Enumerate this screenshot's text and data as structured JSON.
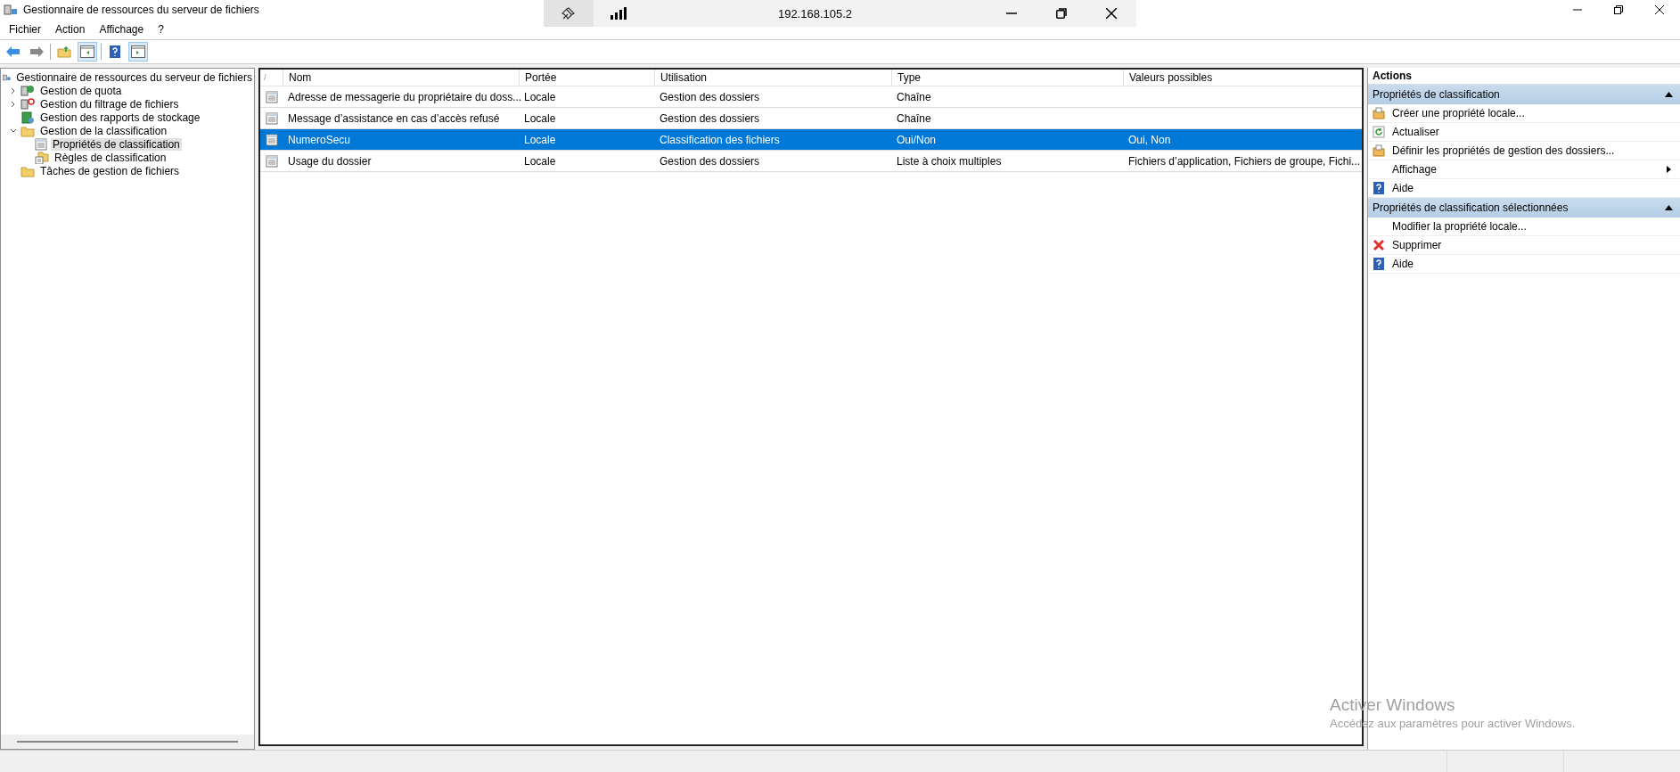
{
  "window": {
    "title": "Gestionnaire de ressources du serveur de fichiers"
  },
  "remote_bar": {
    "address": "192.168.105.2"
  },
  "menu": [
    {
      "label": "Fichier"
    },
    {
      "label": "Action"
    },
    {
      "label": "Affichage"
    },
    {
      "label": "?"
    }
  ],
  "tree": {
    "label": "Gestionnaire de ressources du serveur de fichiers",
    "selected": false,
    "children": [
      {
        "label": "Gestion de quota",
        "kind": "quota",
        "expanded": false,
        "selected": false
      },
      {
        "label": "Gestion du filtrage de fichiers",
        "kind": "filter",
        "expanded": false,
        "selected": false
      },
      {
        "label": "Gestion des rapports de stockage",
        "kind": "report",
        "selected": false
      },
      {
        "label": "Gestion de la classification",
        "kind": "folder",
        "expanded": true,
        "selected": false,
        "children": [
          {
            "label": "Propriétés de classification",
            "kind": "list",
            "selected": true
          },
          {
            "label": "Règles de classification",
            "kind": "rules",
            "selected": false
          }
        ]
      },
      {
        "label": "Tâches de gestion de fichiers",
        "kind": "folder",
        "selected": false
      }
    ]
  },
  "table": {
    "sort_mark": "/",
    "columns": [
      "Nom",
      "Portée",
      "Utilisation",
      "Type",
      "Valeurs possibles"
    ],
    "rows": [
      {
        "selected": false,
        "cells": [
          "Adresse de messagerie du propriétaire du doss...",
          "Locale",
          "Gestion des dossiers",
          "Chaîne",
          ""
        ]
      },
      {
        "selected": false,
        "cells": [
          "Message d’assistance en cas d’accès refusé",
          "Locale",
          "Gestion des dossiers",
          "Chaîne",
          ""
        ]
      },
      {
        "selected": true,
        "cells": [
          "NumeroSecu",
          "Locale",
          "Classification des fichiers",
          "Oui/Non",
          "Oui, Non"
        ]
      },
      {
        "selected": false,
        "cells": [
          "Usage du dossier",
          "Locale",
          "Gestion des dossiers",
          "Liste à choix multiples",
          "Fichiers d’application, Fichiers de groupe, Fichi..."
        ]
      }
    ]
  },
  "actions": {
    "title": "Actions",
    "sections": [
      {
        "title": "Propriétés de classification",
        "expanded": true,
        "items": [
          {
            "label": "Créer une propriété locale...",
            "kind": "create",
            "has_submenu": false
          },
          {
            "label": "Actualiser",
            "kind": "refresh",
            "has_submenu": false
          },
          {
            "label": "Définir les propriétés de gestion des dossiers...",
            "kind": "create",
            "has_submenu": false
          },
          {
            "label": "Affichage",
            "kind": "none",
            "has_submenu": true
          },
          {
            "label": "Aide",
            "kind": "help",
            "has_submenu": false
          }
        ]
      },
      {
        "title": "Propriétés de classification sélectionnées",
        "expanded": true,
        "items": [
          {
            "label": "Modifier la propriété locale...",
            "kind": "none",
            "has_submenu": false
          },
          {
            "label": "Supprimer",
            "kind": "delete",
            "has_submenu": false
          },
          {
            "label": "Aide",
            "kind": "help",
            "has_submenu": false
          }
        ]
      }
    ]
  },
  "activation_notice": {
    "title": "Activer Windows",
    "subtitle": "Accédez aux paramètres pour activer Windows."
  }
}
